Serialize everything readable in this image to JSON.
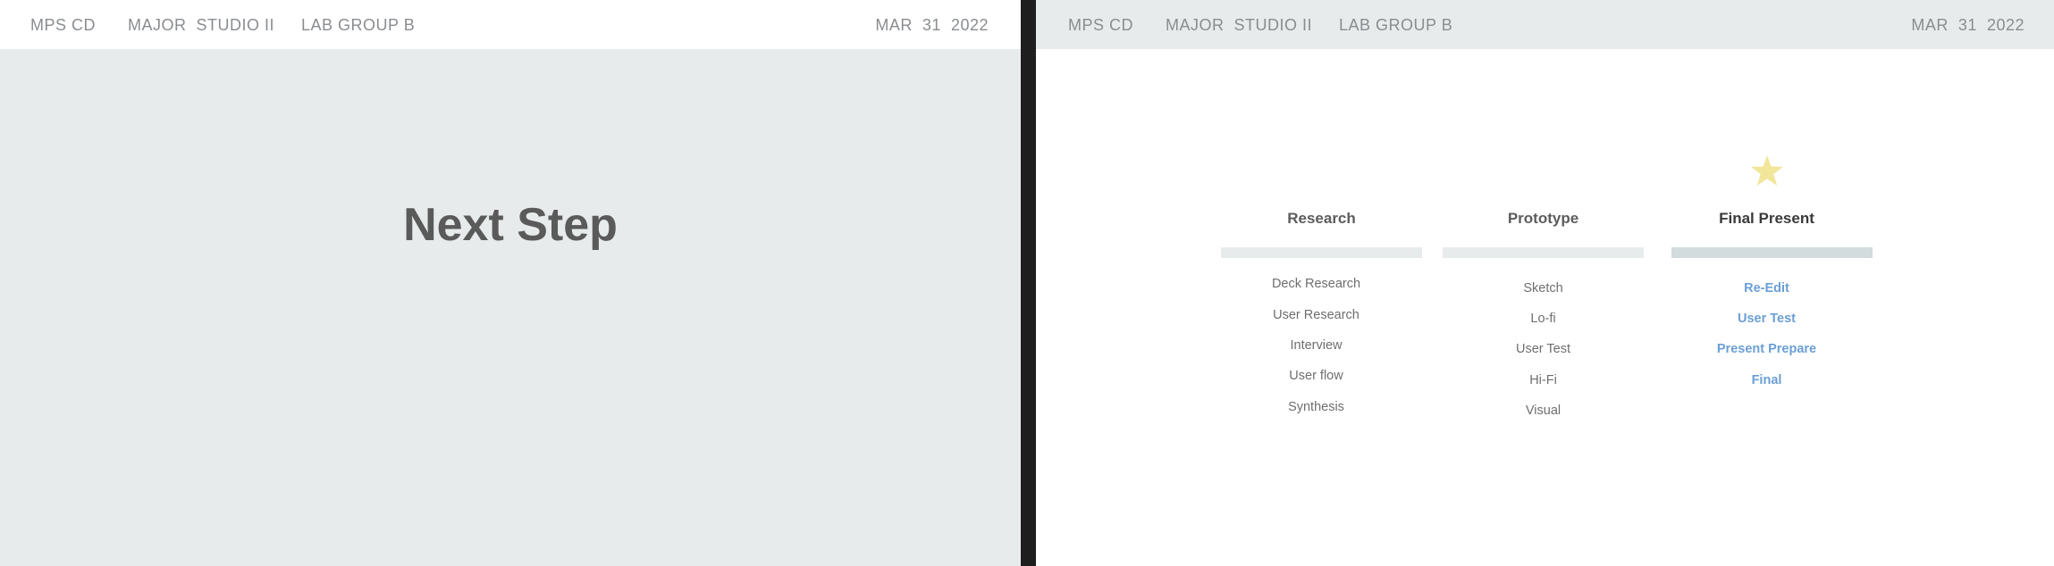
{
  "left_slide": {
    "header": {
      "program": "MPS CD",
      "course": "MAJOR  STUDIO II",
      "group": "LAB GROUP B",
      "date": "MAR  31  2022"
    },
    "title": "Next Step"
  },
  "right_slide": {
    "header": {
      "program": "MPS CD",
      "course": "MAJOR  STUDIO II",
      "group": "LAB GROUP B",
      "date": "MAR  31  2022"
    },
    "star_icon": "star-icon",
    "columns": [
      {
        "heading": "Research",
        "items": [
          "Deck  Research",
          "User Research",
          "Interview",
          "User flow",
          "Synthesis"
        ]
      },
      {
        "heading": "Prototype",
        "items": [
          "Sketch",
          "Lo-fi",
          "User Test",
          "Hi-Fi",
          "Visual"
        ]
      },
      {
        "heading": "Final Present",
        "items": [
          "Re-Edit",
          "User Test",
          "Present Prepare",
          "Final"
        ]
      }
    ]
  },
  "colors": {
    "accent_link": "#6b9fd6",
    "star": "#f2e69b",
    "header_text": "#8a8d90",
    "panel_gray": "#e8ebec",
    "divider": "#1e1e1e"
  }
}
